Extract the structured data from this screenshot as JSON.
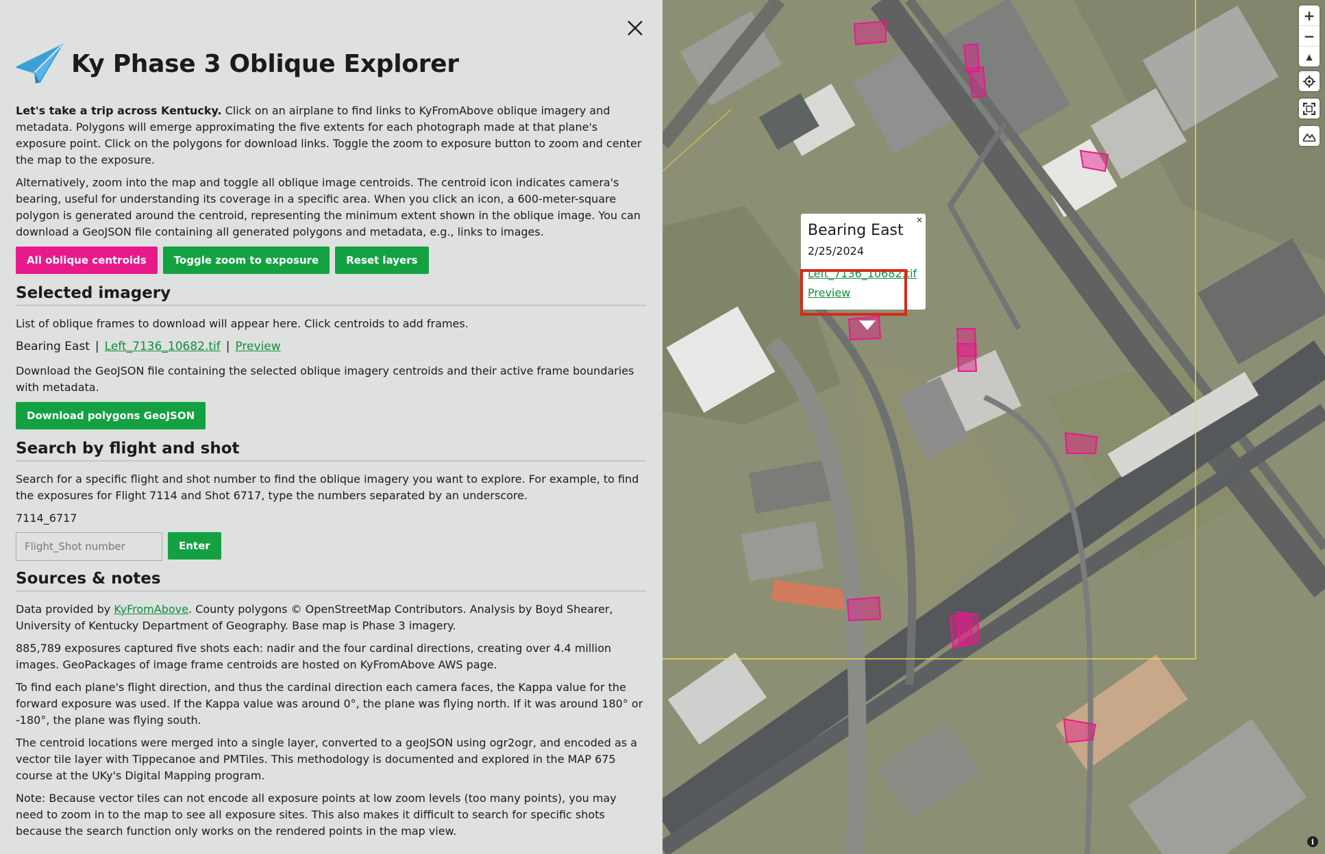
{
  "colors": {
    "pink": "#e8198b",
    "green": "#13a142",
    "link": "#108d3a",
    "highlight": "#d42a1a"
  },
  "header": {
    "title": "Ky Phase 3 Oblique Explorer",
    "logo_icon": "paper-plane-icon"
  },
  "intro": {
    "p1_bold": "Let's take a trip across Kentucky.",
    "p1_rest": " Click on an airplane to find links to KyFromAbove oblique imagery and metadata. Polygons will emerge approximating the five extents for each photograph made at that plane's exposure point. Click on the polygons for download links. Toggle the zoom to exposure button to zoom and center the map to the exposure.",
    "p2": "Alternatively, zoom into the map and toggle all oblique image centroids. The centroid icon indicates camera's bearing, useful for understanding its coverage in a specific area. When you click an icon, a 600-meter-square polygon is generated around the centroid, representing the minimum extent shown in the oblique image. You can download a GeoJSON file containing all generated polygons and metadata, e.g., links to images."
  },
  "buttons": {
    "all_centroids": "All oblique centroids",
    "toggle_zoom": "Toggle zoom to exposure",
    "reset_layers": "Reset layers"
  },
  "selected": {
    "heading": "Selected imagery",
    "desc": "List of oblique frames to download will appear here. Click centroids to add frames.",
    "item_bearing": "Bearing East",
    "item_sep": "|",
    "item_file": "Left_7136_10682.tif",
    "item_preview": "Preview",
    "download_desc": "Download the GeoJSON file containing the selected oblique imagery centroids and their active frame boundaries with metadata.",
    "download_button": "Download polygons GeoJSON"
  },
  "search": {
    "heading": "Search by flight and shot",
    "desc": "Search for a specific flight and shot number to find the oblique imagery you want to explore. For example, to find the exposures for Flight 7114 and Shot 6717, type the numbers separated by an underscore.",
    "example": "7114_6717",
    "placeholder": "Flight_Shot number",
    "enter": "Enter"
  },
  "sources": {
    "heading": "Sources & notes",
    "p1_pre": "Data provided by ",
    "p1_link": "KyFromAbove",
    "p1_post": ". County polygons © OpenStreetMap Contributors. Analysis by Boyd Shearer, University of Kentucky Department of Geography. Base map is Phase 3 imagery.",
    "p2": "885,789 exposures captured five shots each: nadir and the four cardinal directions, creating over 4.4 million images. GeoPackages of image frame centroids are hosted on KyFromAbove AWS page.",
    "p3": "To find each plane's flight direction, and thus the cardinal direction each camera faces, the Kappa value for the forward exposure was used. If the Kappa value was around 0°, the plane was flying north. If it was around 180° or -180°, the plane was flying south.",
    "p4": "The centroid locations were merged into a single layer, converted to a geoJSON using ogr2ogr, and encoded as a vector tile layer with Tippecanoe and PMTiles. This methodology is documented and explored in the MAP 675 course at the UKy's Digital Mapping program.",
    "p5": "Note: Because vector tiles can not encode all exposure points at low zoom levels (too many points), you may need to zoom in to the map to see all exposure sites. This also makes it difficult to search for specific shots because the search function only works on the rendered points in the map view."
  },
  "popup": {
    "title": "Bearing East",
    "date": "2/25/2024",
    "file_link": "Left_7136_10682.tif",
    "preview_link": "Preview",
    "close": "×"
  },
  "map_controls": {
    "zoom_in": "+",
    "zoom_out": "−",
    "compass": "▲",
    "geolocate_icon": "crosshair-icon",
    "fullscreen_icon": "fullscreen-icon",
    "terrain_icon": "terrain-icon",
    "info": "i"
  }
}
